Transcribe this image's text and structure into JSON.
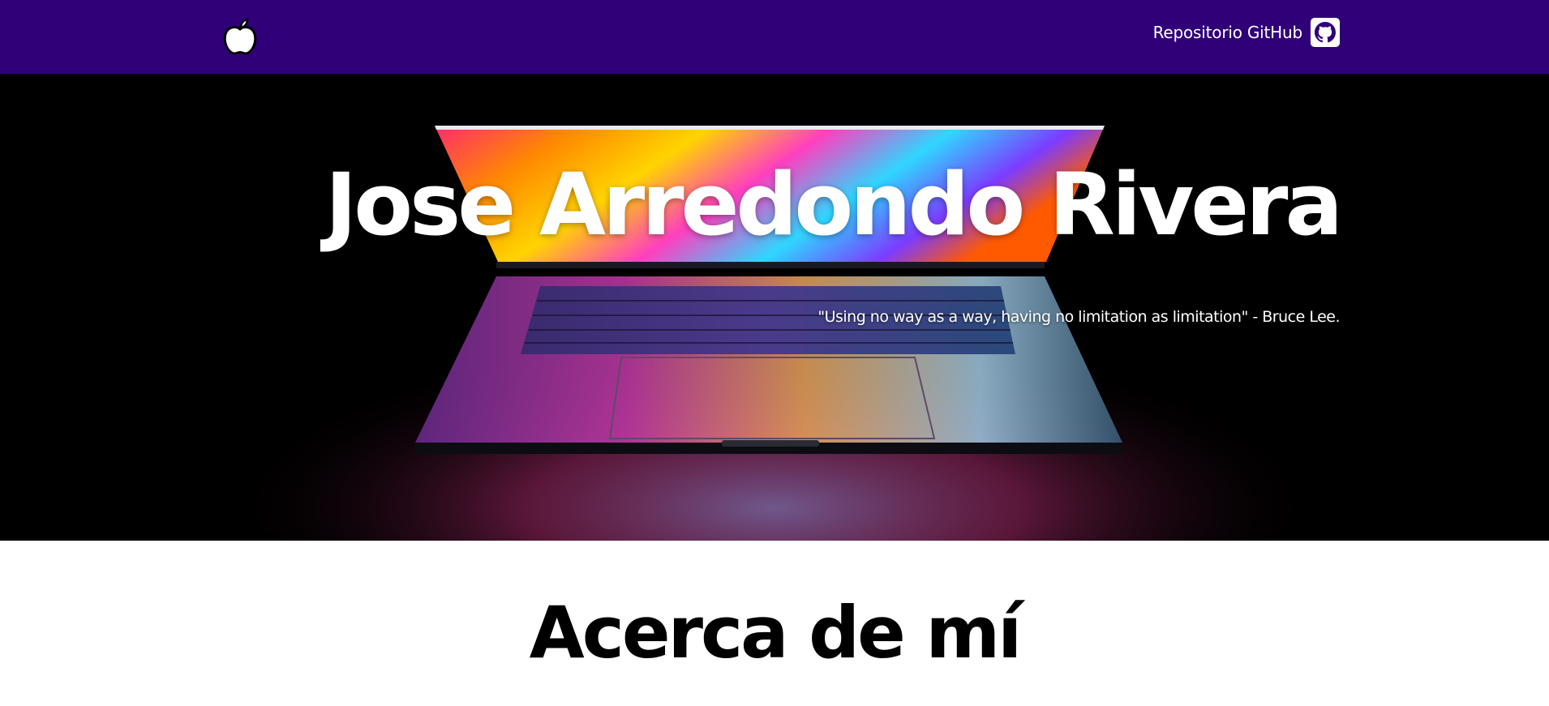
{
  "nav": {
    "logo_icon": "apple-icon",
    "repo_label": "Repositorio GitHub",
    "repo_icon": "github-icon",
    "background": "#300078"
  },
  "hero": {
    "title": "Jose Arredondo Rivera",
    "quote": "\"Using no way as a way, having no limitation as limitation\" - Bruce Lee.",
    "background_image": "laptop-photo"
  },
  "about": {
    "title": "Acerca de mí"
  }
}
